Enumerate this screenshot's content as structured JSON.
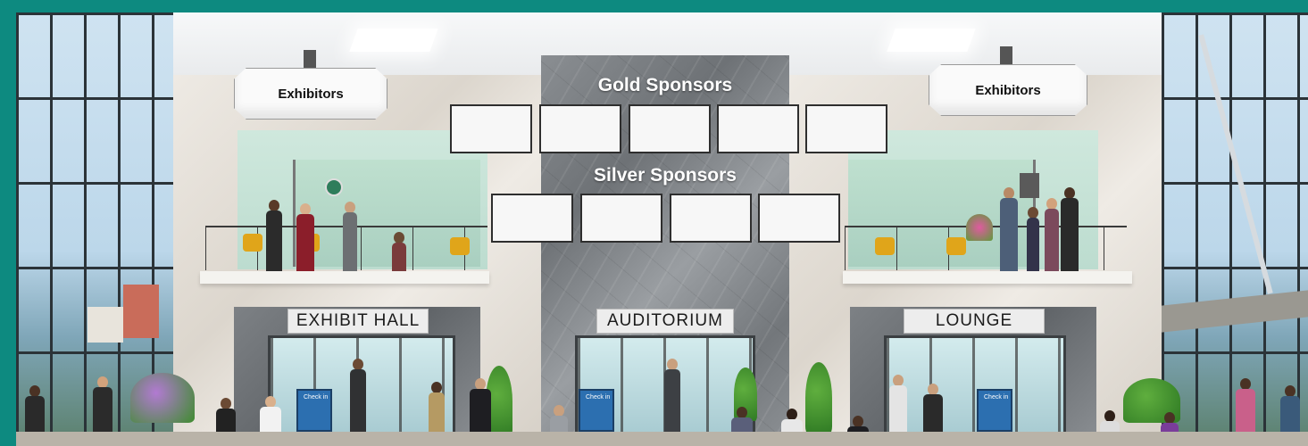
{
  "signs": {
    "exhibitors_left": "Exhibitors",
    "exhibitors_right": "Exhibitors",
    "gold_sponsors": "Gold Sponsors",
    "silver_sponsors": "Silver Sponsors"
  },
  "doors": {
    "exhibit_hall": "EXHIBIT HALL",
    "auditorium": "AUDITORIUM",
    "lounge": "LOUNGE"
  },
  "kiosk_label": "Check in",
  "colors": {
    "border_teal": "#0d8a80",
    "column_gray": "#7a7e82",
    "kiosk_blue": "#2c6fb0",
    "chair_yellow": "#e0a51a"
  },
  "sponsor_slots": {
    "gold": 5,
    "silver": 4
  }
}
